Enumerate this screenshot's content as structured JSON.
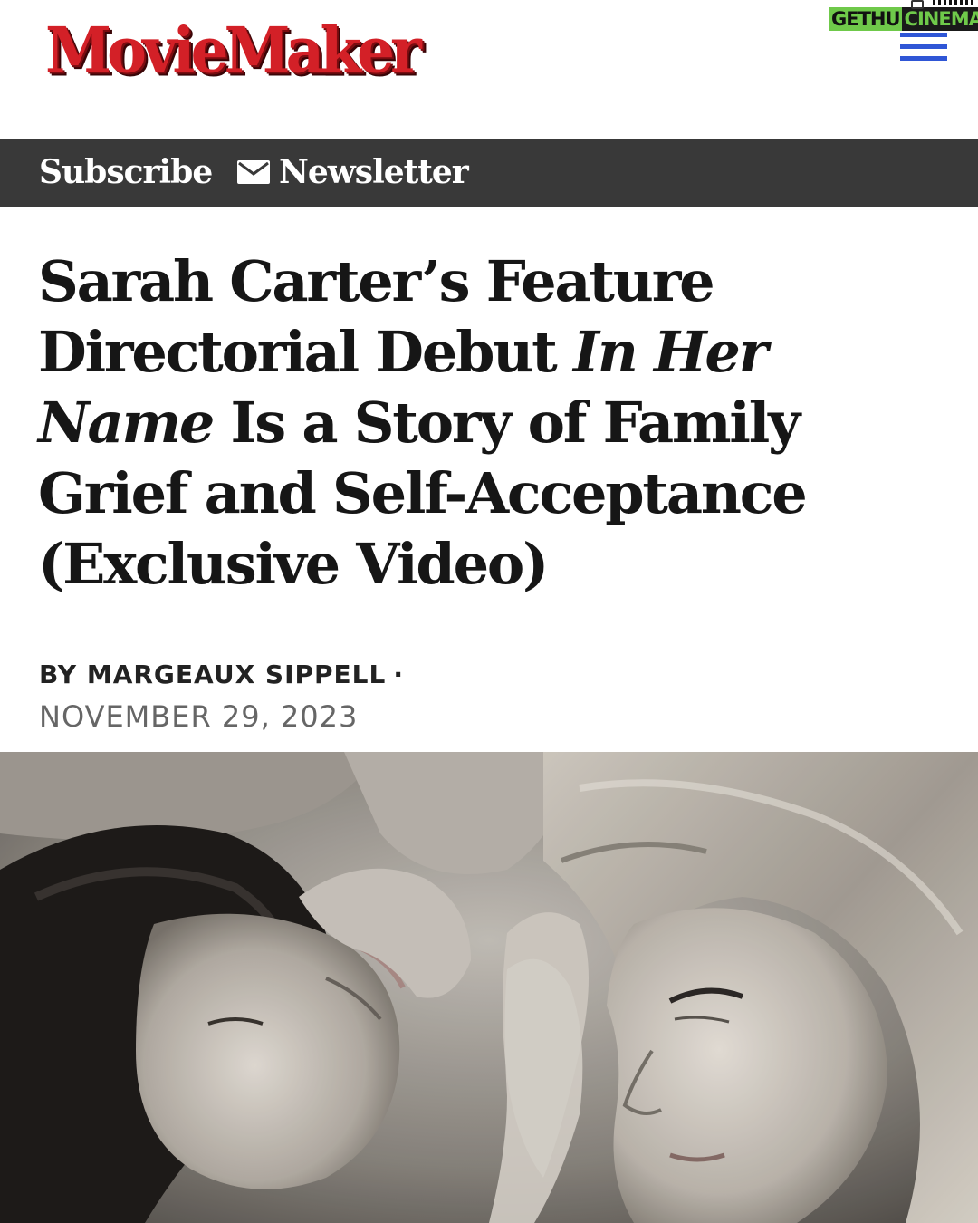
{
  "brand": {
    "logo_text": "MovieMaker",
    "watermark_part1": "GETHU",
    "watermark_part2": "CINEMA",
    "accent_color": "#d32027",
    "menu_color": "#2f56d6"
  },
  "nav": {
    "subscribe_label": "Subscribe",
    "newsletter_label": "Newsletter",
    "newsletter_icon": "envelope-icon",
    "menu_icon": "hamburger-menu-icon",
    "background": "#393939"
  },
  "article": {
    "headline_part1": "Sarah Carter’s Feature Directorial Debut ",
    "headline_italic": "In Her Name",
    "headline_part2": " Is a Story of Family Grief and Self-Acceptance (Exclusive Video)",
    "byline": "BY MARGEAUX SIPPELL",
    "byline_separator": "·",
    "date": "NOVEMBER 29, 2023"
  }
}
